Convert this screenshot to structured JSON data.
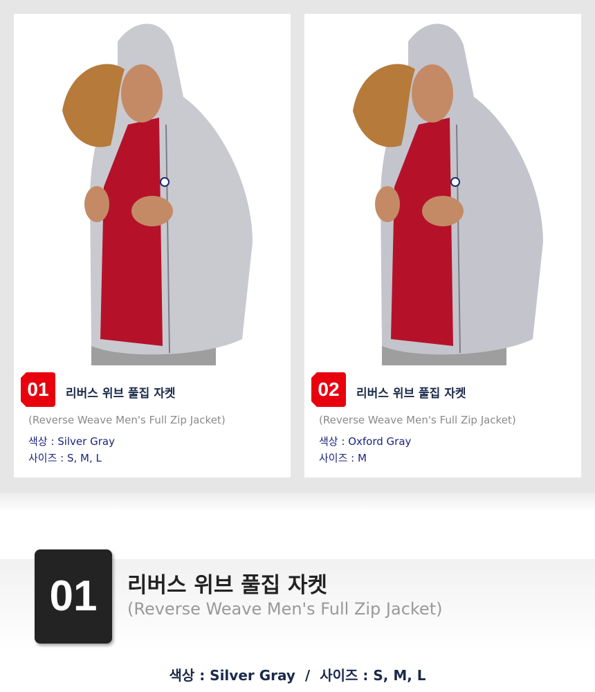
{
  "products": [
    {
      "number": "01",
      "title": "리버스 위브 풀집 자켓",
      "subtitle": "(Reverse Weave Men's Full Zip Jacket)",
      "color_line": "색상 : Silver Gray",
      "size_line": "사이즈 : S, M, L",
      "jacket_color": "#c9c9d0"
    },
    {
      "number": "02",
      "title": "리버스 위브 풀집 자켓",
      "subtitle": "(Reverse Weave Men's Full Zip Jacket)",
      "color_line": "색상 : Oxford Gray",
      "size_line": "사이즈 : M",
      "jacket_color": "#c4c4cc"
    }
  ],
  "detail": {
    "number": "01",
    "title": "리버스 위브 풀집 자켓",
    "subtitle": "(Reverse Weave Men's Full Zip Jacket)",
    "color_text": "색상 : Silver Gray",
    "separator": "/",
    "size_text": "사이즈 : S, M, L"
  },
  "colors": {
    "badge_red": "#e8000e",
    "big_badge": "#232323",
    "title_navy": "#1a2a4a",
    "info_blue": "#1a237e"
  }
}
